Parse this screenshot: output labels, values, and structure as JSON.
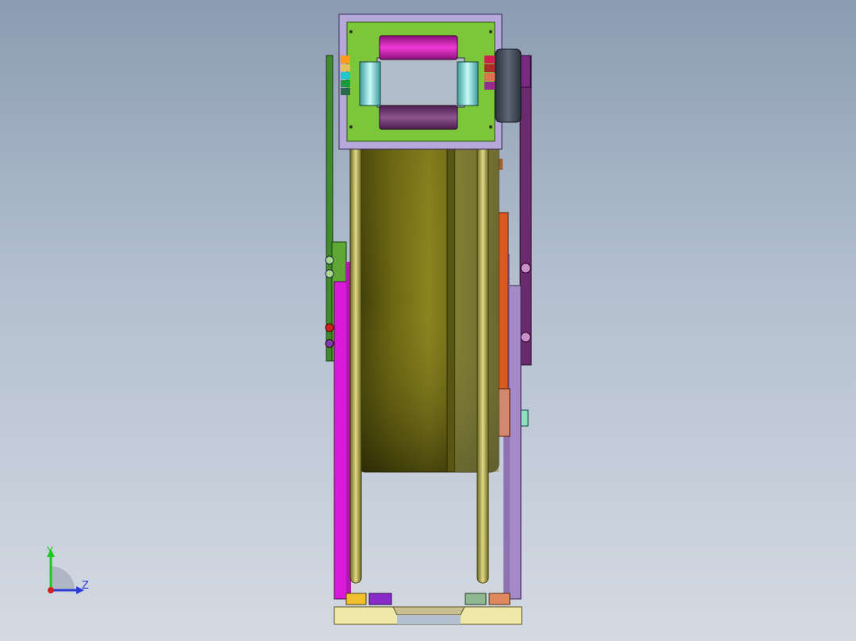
{
  "viewport": {
    "name": "cad-graphics-area",
    "background_top": "#8b9cb2",
    "background_bottom": "#d4dae3"
  },
  "model": {
    "view": "side-view",
    "colors": {
      "drum": "#7f7a17",
      "drum_rim": "#c9bd6a",
      "side_plate_left": "#d91bd9",
      "side_plate_right": "#a58ac9",
      "top_frame": "#7cc63a",
      "top_roller": "#cc1aa8",
      "bottom_roller": "#7a3c78",
      "side_rollers": "#8fe0df",
      "pulley": "#434b5a",
      "chain": "#d95a1e",
      "base": "#eee9a8"
    }
  },
  "triad": {
    "y_label": "Y",
    "z_label": "Z",
    "y_color": "#1ec81e",
    "z_color": "#2b3bd6",
    "x_color": "#d02020"
  }
}
